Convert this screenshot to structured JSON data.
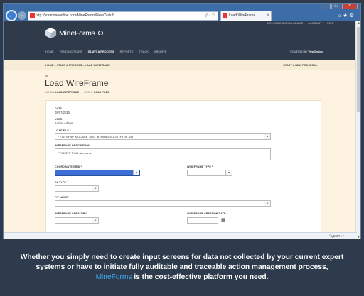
{
  "browser": {
    "address": "http://yourmineonline.com/MineForms/New/Task/8",
    "address_tools": "ρ - ↻",
    "tab_title": "Load WireFrame | Processo...",
    "tab_close": "×"
  },
  "header": {
    "user_links": [
      "WELCOME ADRIAN ADAMS",
      "ACCOUNT",
      "HELP"
    ],
    "logo_text": "MineForms",
    "nav": [
      "HOME",
      "PENDING TASKS",
      "START A PROCESS",
      "REPORTS",
      "TRACK",
      "ARCHIVE"
    ],
    "nav_active": "START A PROCESS",
    "powered_prefix": "POWERED BY",
    "powered_brand": "ViewCentric"
  },
  "breadcrumb": "HOME > START A PROCESS > LOAD WIREFRAME",
  "start_new": "START A NEW PROCESS >",
  "page": {
    "id": "40",
    "title": "Load WireFrame",
    "meta_model_label": "MODEL",
    "meta_model": "LOAD WIREFRAME",
    "meta_group_label": "GROUP",
    "meta_group": "LOAD FILES"
  },
  "form": {
    "date_label": "DATE",
    "date_value": "08/07/2015",
    "user_label": "USER",
    "user_value": "Adrian Adams",
    "load_file_label": "LOAD FILE *",
    "load_file_value": "FY15_SYNP_MOCASE_MAC_B_MINEDSOLID_FY15_.DB",
    "description_label": "WIREFRAME DESCRIPTION",
    "description_value": "FY15 SYP FY15 wireframe",
    "coord_label": "COORDINATE GRID *",
    "wf_type_label": "WIREFRAME TYPE *",
    "rl_type_label": "RL TYPE *",
    "pit_name_label": "PIT NAME *",
    "creator_label": "WIREFRAME CREATOR *",
    "creation_date_label": "WIREFRAME CREATION DATE *"
  },
  "status": {
    "zoom": "🔍100% ▾"
  },
  "caption": {
    "text_before": "Whether you simply need to create input screens for data not collected by your current expert systems or have to initiate fully auditable and traceable action management process,",
    "brand": "MineForms",
    "text_after": "is the cost-effective platform you need."
  },
  "colors": {
    "header_bg": "#2f3a4a",
    "page_bg": "#fdf3e0",
    "brand_link": "#3fa9f5",
    "browser_chrome": "#3c6da8"
  }
}
